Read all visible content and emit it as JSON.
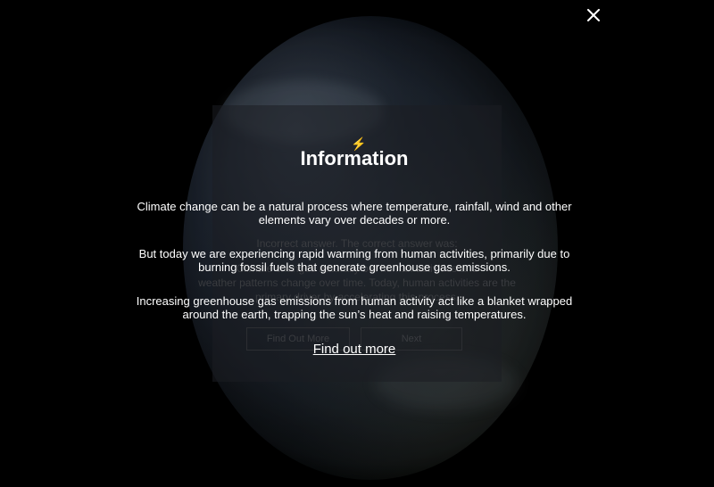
{
  "background": {
    "quiz": {
      "feedback_line_1": "Incorrect answer. The correct answer was:",
      "feedback_line_2": "Climate changes naturally but human activities and",
      "feedback_line_3": "weather patterns change over time. Today, human activities are the",
      "feedback_line_4": "primary driver by accelerating this process.",
      "find_out_more_button": "Find Out More",
      "next_button": "Next"
    }
  },
  "info": {
    "title": "Information",
    "paragraphs": [
      "Climate change can be a natural process where temperature, rainfall, wind and other elements vary over decades or more.",
      "But today we are experiencing rapid warming from human activities, primarily due to burning fossil fuels that generate greenhouse gas emissions.",
      "Increasing greenhouse gas emissions from human activity act like a blanket wrapped around the earth, trapping the sun’s heat and raising temperatures."
    ],
    "link": "Find out more"
  },
  "icons": {
    "close": "close-icon"
  },
  "colors": {
    "background": "#000000",
    "text": "#ffffff"
  }
}
